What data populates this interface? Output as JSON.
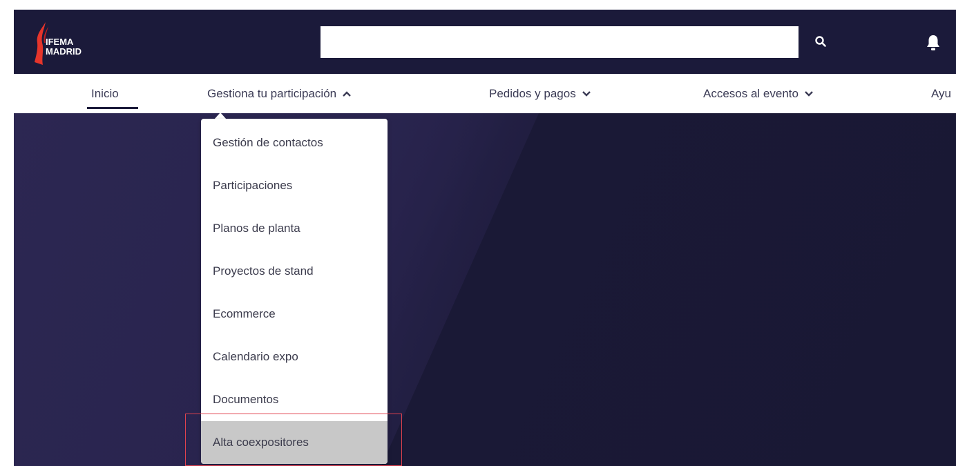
{
  "header": {
    "logo_line1": "IFEMA",
    "logo_line2": "MADRID",
    "search": {
      "value": "",
      "placeholder": ""
    },
    "icons": {
      "search": "search-icon",
      "notifications": "bell-icon"
    }
  },
  "nav": {
    "items": [
      {
        "label": "Inicio",
        "active": true,
        "chevron": "none"
      },
      {
        "label": "Gestiona tu participación",
        "active": false,
        "chevron": "up"
      },
      {
        "label": "Pedidos y pagos",
        "active": false,
        "chevron": "down"
      },
      {
        "label": "Accesos al evento",
        "active": false,
        "chevron": "down"
      },
      {
        "label": "Ayu",
        "active": false,
        "chevron": "none"
      }
    ]
  },
  "dropdown": {
    "items": [
      {
        "label": "Gestión de contactos"
      },
      {
        "label": "Participaciones"
      },
      {
        "label": "Planos de planta"
      },
      {
        "label": "Proyectos de stand"
      },
      {
        "label": "Ecommerce"
      },
      {
        "label": "Calendario expo"
      },
      {
        "label": "Documentos"
      },
      {
        "label": "Alta coexpositores",
        "highlighted": true
      }
    ]
  },
  "colors": {
    "header_bg": "#1b1a3a",
    "logo_red": "#e6352b",
    "highlight_bg": "#c8c8c8",
    "annotation_red": "#e0424e"
  }
}
